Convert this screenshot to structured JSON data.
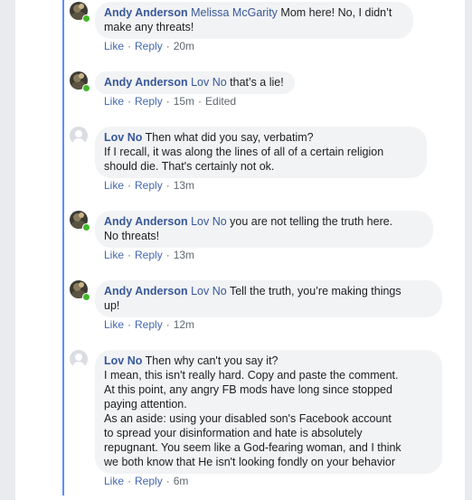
{
  "actions": {
    "like": "Like",
    "reply": "Reply",
    "separator": "·",
    "edited": "Edited"
  },
  "comments": [
    {
      "author": "Andy Anderson",
      "tag": "Melissa McGarity",
      "lines": [
        "Mom here! No, I didn’t",
        "make any threats!"
      ],
      "first_line_suffix": " Mom here! No, I didn’t",
      "time": "20m"
    },
    {
      "author": "Andy Anderson",
      "tag": "Lov No",
      "first_line_suffix": " that’s a lie!",
      "time": "15m"
    },
    {
      "author": "Lov No",
      "first_line_suffix": " Then what did you say, verbatim?",
      "extra_lines": [
        "If I recall, it was along the lines of all of a certain religion",
        "should die. That's certainly not ok."
      ],
      "time": "13m"
    },
    {
      "author": "Andy Anderson",
      "tag": "Lov No",
      "first_line_suffix": " you are not telling the truth here.",
      "extra_lines": [
        "No threats!"
      ],
      "time": "13m"
    },
    {
      "author": "Andy Anderson",
      "tag": "Lov No",
      "first_line_suffix": " Tell the truth, you’re making things",
      "extra_lines": [
        "up!"
      ],
      "time": "12m"
    },
    {
      "author": "Lov No",
      "first_line_suffix": " Then why can't you say it?",
      "extra_lines": [
        "I mean, this isn't really hard. Copy and paste the comment.",
        "At this point, any angry FB mods have long since stopped",
        "paying attention.",
        "As an aside: using your disabled son's Facebook account",
        "to spread your disinformation and hate is absolutely",
        "repugnant. You seem like a God-fearing woman, and I think",
        "we both know that He isn't looking fondly on your behavior"
      ],
      "time": "6m"
    }
  ]
}
